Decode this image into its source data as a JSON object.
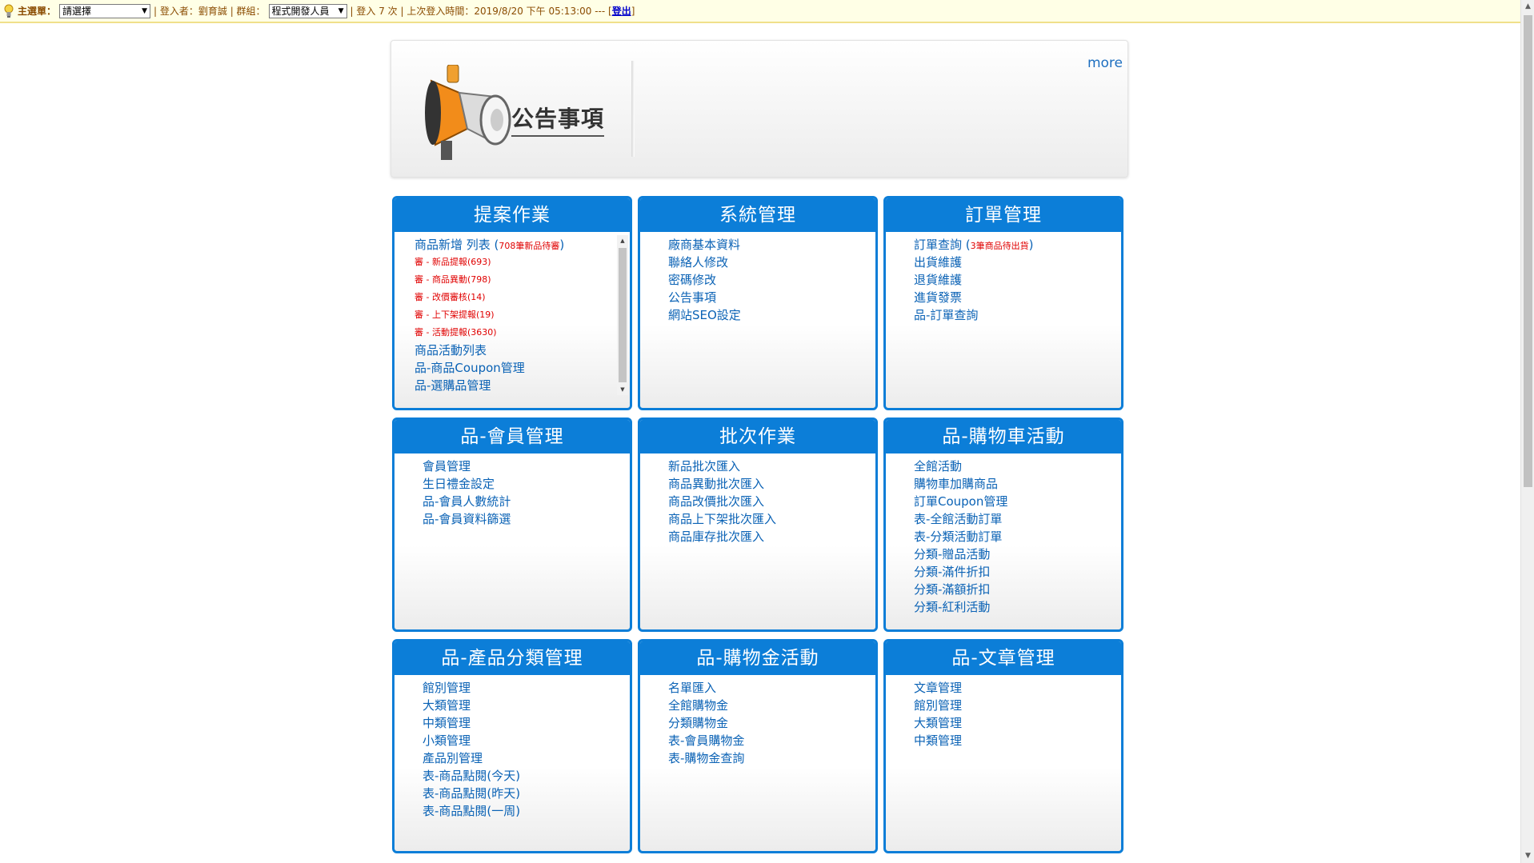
{
  "topbar": {
    "main_menu_label": "主選單：",
    "main_menu_value": "請選擇",
    "login_user": "| 登入者：劉育誠 | 群組：",
    "group_value": "程式開發人員",
    "login_info": "| 登入 7 次 | 上次登入時間：2019/8/20 下午 05:13:00 --- [",
    "logout_label": "登出",
    "close_bracket": "]"
  },
  "announcement": {
    "title": "公告事項",
    "more": "more"
  },
  "panels": [
    {
      "title": "提案作業",
      "items": [
        {
          "text": "商品新增 列表 (",
          "badge": "708筆新品待審",
          "end": ")"
        },
        {
          "text": "審 - 新品提報(693)",
          "red": true
        },
        {
          "text": "審 - 商品異動(798)",
          "red": true
        },
        {
          "text": "審 - 改價審核(14)",
          "red": true
        },
        {
          "text": "審 - 上下架提報(19)",
          "red": true
        },
        {
          "text": "審 - 活動提報(3630)",
          "red": true
        },
        {
          "text": "商品活動列表"
        },
        {
          "text": "品-商品Coupon管理"
        },
        {
          "text": "品-選購品管理"
        }
      ]
    },
    {
      "title": "系統管理",
      "items": [
        {
          "text": "廠商基本資料"
        },
        {
          "text": "聯絡人修改"
        },
        {
          "text": "密碼修改"
        },
        {
          "text": "公告事項"
        },
        {
          "text": "網站SEO設定"
        }
      ]
    },
    {
      "title": "訂單管理",
      "items": [
        {
          "text": "訂單查詢 (",
          "badge": "3筆商品待出貨",
          "end": ")"
        },
        {
          "text": "出貨維護"
        },
        {
          "text": "退貨維護"
        },
        {
          "text": "進貨發票"
        },
        {
          "text": "品-訂單查詢"
        }
      ]
    },
    {
      "title": "品-會員管理",
      "items": [
        {
          "text": "會員管理"
        },
        {
          "text": "生日禮金設定"
        },
        {
          "text": "品-會員人數統計"
        },
        {
          "text": "品-會員資料篩選"
        }
      ]
    },
    {
      "title": "批次作業",
      "items": [
        {
          "text": "新品批次匯入"
        },
        {
          "text": "商品異動批次匯入"
        },
        {
          "text": "商品改價批次匯入"
        },
        {
          "text": "商品上下架批次匯入"
        },
        {
          "text": "商品庫存批次匯入"
        }
      ]
    },
    {
      "title": "品-購物車活動",
      "items": [
        {
          "text": "全館活動"
        },
        {
          "text": "購物車加購商品"
        },
        {
          "text": "訂單Coupon管理"
        },
        {
          "text": "表-全館活動訂單"
        },
        {
          "text": "表-分類活動訂單"
        },
        {
          "text": "分類-贈品活動"
        },
        {
          "text": "分類-滿件折扣"
        },
        {
          "text": "分類-滿額折扣"
        },
        {
          "text": "分類-紅利活動"
        }
      ]
    },
    {
      "title": "品-產品分類管理",
      "items": [
        {
          "text": "館別管理"
        },
        {
          "text": "大類管理"
        },
        {
          "text": "中類管理"
        },
        {
          "text": "小類管理"
        },
        {
          "text": "產品別管理"
        },
        {
          "text": "表-商品點閱(今天)"
        },
        {
          "text": "表-商品點閱(昨天)"
        },
        {
          "text": "表-商品點閱(一周)"
        }
      ]
    },
    {
      "title": "品-購物金活動",
      "items": [
        {
          "text": "名單匯入"
        },
        {
          "text": "全館購物金"
        },
        {
          "text": "分類購物金"
        },
        {
          "text": "表-會員購物金"
        },
        {
          "text": "表-購物金查詢"
        }
      ]
    },
    {
      "title": "品-文章管理",
      "items": [
        {
          "text": "文章管理"
        },
        {
          "text": "館別管理"
        },
        {
          "text": "大類管理"
        },
        {
          "text": "中類管理"
        }
      ]
    }
  ]
}
